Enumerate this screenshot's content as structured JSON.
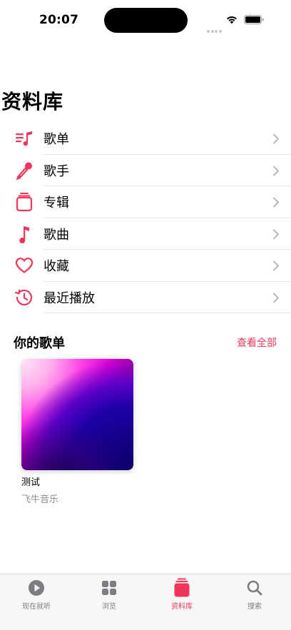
{
  "status_bar": {
    "time": "20:07"
  },
  "page_title": "资料库",
  "menu": [
    {
      "label": "歌单",
      "icon": "playlist-icon"
    },
    {
      "label": "歌手",
      "icon": "microphone-icon"
    },
    {
      "label": "专辑",
      "icon": "album-stack-icon"
    },
    {
      "label": "歌曲",
      "icon": "music-note-icon"
    },
    {
      "label": "收藏",
      "icon": "heart-icon"
    },
    {
      "label": "最近播放",
      "icon": "history-icon"
    }
  ],
  "section": {
    "title": "你的歌单",
    "see_all": "查看全部"
  },
  "playlists": [
    {
      "name": "测试",
      "subtitle": "飞牛音乐"
    }
  ],
  "tabs": [
    {
      "label": "现在就听",
      "icon": "play-circle-icon",
      "active": false
    },
    {
      "label": "浏览",
      "icon": "grid-icon",
      "active": false
    },
    {
      "label": "资料库",
      "icon": "library-icon",
      "active": true
    },
    {
      "label": "搜索",
      "icon": "search-icon",
      "active": false
    }
  ],
  "colors": {
    "accent": "#f0355a",
    "tab_inactive": "#7d7d82",
    "secondary_text": "#8e8e93"
  }
}
